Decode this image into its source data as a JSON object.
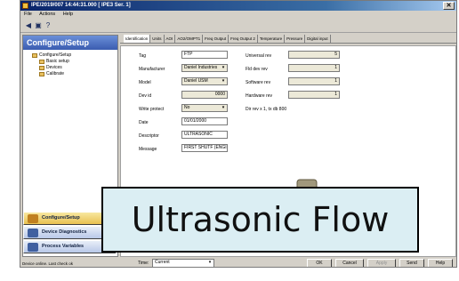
{
  "window": {
    "title": "IPE/2019/007 14:44:31.000 [ IPE3 Ser. 1]"
  },
  "menu": [
    "File",
    "Actions",
    "Help"
  ],
  "left": {
    "header": "Configure/Setup",
    "tree": [
      {
        "label": "Configure/Setup",
        "level": 1
      },
      {
        "label": "Basic setup",
        "level": 2
      },
      {
        "label": "Devices",
        "level": 2
      },
      {
        "label": "Calibrate",
        "level": 2
      }
    ],
    "nav": [
      {
        "label": "Configure/Setup",
        "active": true
      },
      {
        "label": "Device Diagnostics",
        "active": false
      },
      {
        "label": "Process Variables",
        "active": false
      }
    ]
  },
  "tabs": [
    "Identification",
    "Units",
    "AOI",
    "AO2/OMPT1",
    "Freq Output",
    "Freq Output 2",
    "Temperature",
    "Pressure",
    "Digital input"
  ],
  "form": {
    "left_fields": [
      {
        "label": "Tag",
        "value": "FTP"
      },
      {
        "label": "Manufacturer",
        "value": "Daniel Industries"
      },
      {
        "label": "Model",
        "value": "Daniel USM"
      },
      {
        "label": "Dev id",
        "value": "0000"
      },
      {
        "label": "Write protect",
        "value": "No"
      },
      {
        "label": "Date",
        "value": "01/01/2000"
      },
      {
        "label": "Descriptor",
        "value": "ULTRASONIC"
      },
      {
        "label": "Message",
        "value": "FIRST SHUTF (ENGINE)"
      }
    ],
    "right_fields": [
      {
        "label": "Universal rev",
        "value": "5"
      },
      {
        "label": "Fld dev rev",
        "value": "1"
      },
      {
        "label": "Software rev",
        "value": "1"
      },
      {
        "label": "Hardware rev",
        "value": "1"
      }
    ],
    "note": "Dir rev x 1, tx db 800"
  },
  "bottom": {
    "time_label": "Time:",
    "time_value": "Current",
    "buttons": [
      "OK",
      "Cancel",
      "Apply",
      "Send",
      "Help"
    ]
  },
  "status": "Device online. Last check ok",
  "overlay": {
    "text": "Ultrasonic Flow"
  },
  "colors": {
    "titlebar": "#0a246a",
    "active_nav": "#e8c050",
    "overlay_bg": "#dbeef3"
  }
}
